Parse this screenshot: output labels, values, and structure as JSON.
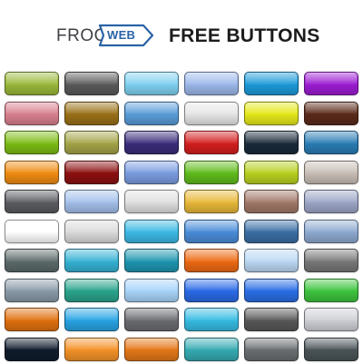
{
  "header": {
    "logo_part1": "FROO",
    "logo_part2": "WEB",
    "title": "FREE BUTTONS",
    "logo_icon": "arrow-tag-icon"
  },
  "button_grid": {
    "columns": 6,
    "rows": [
      [
        "#9ab83a",
        "#5a5a5a",
        "#7fd0f0",
        "#9cb8ea",
        "#1c9ad8",
        "#9c1cd2"
      ],
      [
        "#d8808e",
        "#9a7018",
        "#5a9cd8",
        "#e6e6e6",
        "#e4e81a",
        "#5a2a1a"
      ],
      [
        "#7cbc14",
        "#a4a448",
        "#3a2c7a",
        "#d41e1e",
        "#1a2a3a",
        "#2a7cb4"
      ],
      [
        "#f08c12",
        "#8c1010",
        "#7a9ce0",
        "#60bc1c",
        "#b8d020",
        "#c8beb6"
      ],
      [
        "#5a5c60",
        "#a4c0ea",
        "#e0e0e0",
        "#e8b838",
        "#a07868",
        "#9ca6c6"
      ],
      [
        "#ffffff",
        "#dcdcdc",
        "#3cb8e4",
        "#4a8cd8",
        "#3a6ea4",
        "#8eaad0"
      ],
      [
        "#5c6a6a",
        "#36b2d4",
        "#1e96b0",
        "#ee6a14",
        "#bcd8f4",
        "#787878"
      ],
      [
        "#8a9aa8",
        "#2aa48c",
        "#a8d4fa",
        "#2a6ae6",
        "#2a6ee4",
        "#3ec43e"
      ],
      [
        "#e0700e",
        "#28a4e4",
        "#6a6c70",
        "#36bce4",
        "#585858",
        "#ced0d6"
      ],
      [
        "#101c2c",
        "#f49228",
        "#e47818",
        "#36aab2",
        "#6a6e70",
        "#4a5458"
      ]
    ]
  }
}
